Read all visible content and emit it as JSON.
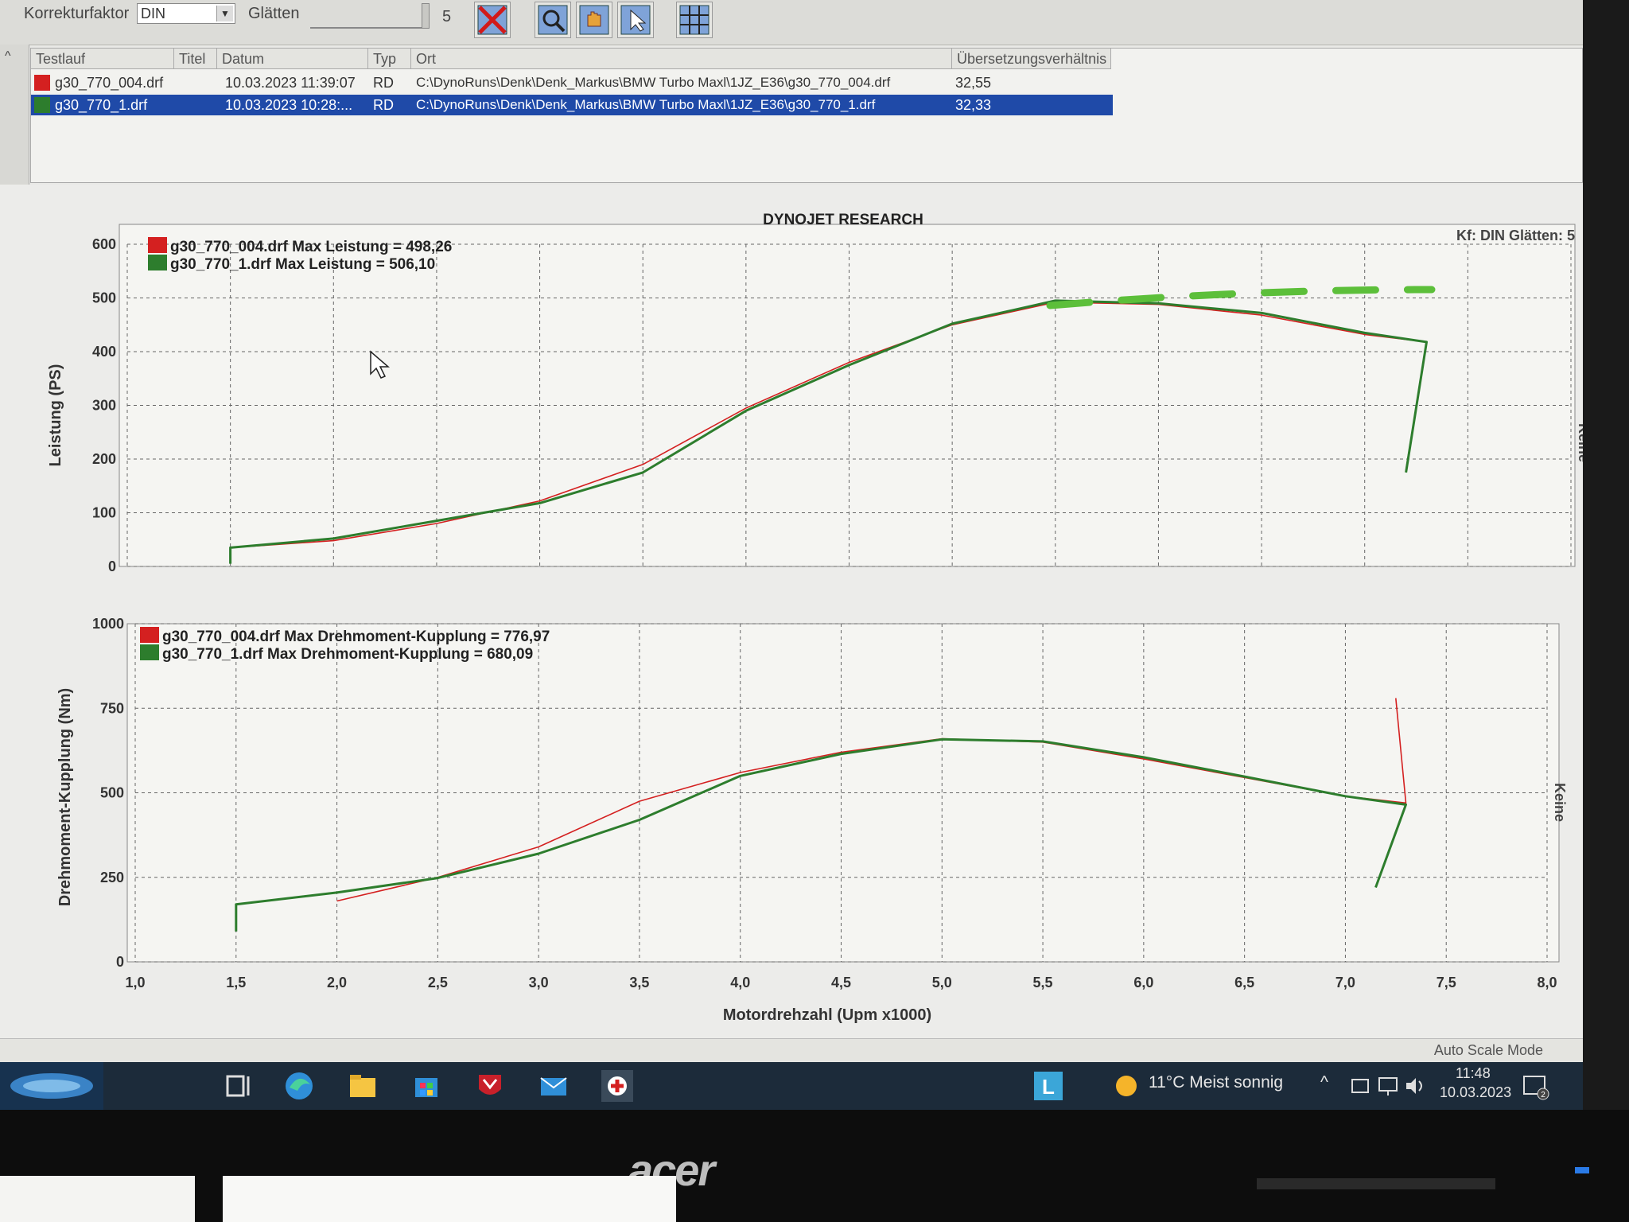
{
  "toolbar": {
    "korrektur_label": "Korrekturfaktor",
    "korrektur_value": "DIN",
    "glaetten_label": "Glätten",
    "glaetten_value": "5"
  },
  "runs_table": {
    "headers": [
      "Testlauf",
      "Titel",
      "Datum",
      "Typ",
      "Ort",
      "Übersetzungsverhältnis"
    ],
    "rows": [
      {
        "testlauf": "g30_770_004.drf",
        "datum": "10.03.2023 11:39:07",
        "typ": "RD",
        "ort": "C:\\DynoRuns\\Denk\\Denk_Markus\\BMW Turbo Maxl\\1JZ_E36\\g30_770_004.drf",
        "ratio": "32,55",
        "color": "#d42020"
      },
      {
        "testlauf": "g30_770_1.drf",
        "datum": "10.03.2023 10:28:...",
        "typ": "RD",
        "ort": "C:\\DynoRuns\\Denk\\Denk_Markus\\BMW Turbo Maxl\\1JZ_E36\\g30_770_1.drf",
        "ratio": "32,33",
        "color": "#2d7d2d"
      }
    ]
  },
  "chart_header": {
    "title": "DYNOJET RESEARCH",
    "kf": "Kf: DIN  Glätten: 5",
    "keine_top": "Keine",
    "keine_bottom": "Keine"
  },
  "chart_data": [
    {
      "type": "line",
      "ylabel": "Leistung (PS)",
      "xlabel": "Motordrehzahl (Upm x1000)",
      "xlim": [
        1.0,
        8.0
      ],
      "ylim": [
        0,
        600
      ],
      "yticks": [
        "0",
        "100",
        "200",
        "300",
        "400",
        "500",
        "600"
      ],
      "grid": true,
      "legend": [
        "g30_770_004.drf Max Leistung = 498,26",
        "g30_770_1.drf Max Leistung = 506,10"
      ],
      "series": [
        {
          "color": "#d42020",
          "points": [
            [
              1.5,
              35
            ],
            [
              2.0,
              48
            ],
            [
              2.5,
              80
            ],
            [
              3.0,
              122
            ],
            [
              3.5,
              190
            ],
            [
              4.0,
              295
            ],
            [
              4.5,
              380
            ],
            [
              5.0,
              450
            ],
            [
              5.5,
              492
            ],
            [
              6.0,
              488
            ],
            [
              6.5,
              468
            ],
            [
              7.0,
              432
            ],
            [
              7.3,
              418
            ],
            [
              7.2,
              180
            ]
          ]
        },
        {
          "color": "#2d7d2d",
          "points": [
            [
              1.5,
              5
            ],
            [
              1.5,
              35
            ],
            [
              2.0,
              52
            ],
            [
              2.5,
              85
            ],
            [
              3.0,
              118
            ],
            [
              3.5,
              175
            ],
            [
              4.0,
              290
            ],
            [
              4.5,
              375
            ],
            [
              5.0,
              452
            ],
            [
              5.5,
              495
            ],
            [
              6.0,
              490
            ],
            [
              6.5,
              472
            ],
            [
              7.0,
              435
            ],
            [
              7.3,
              418
            ],
            [
              7.2,
              175
            ]
          ]
        }
      ]
    },
    {
      "type": "line",
      "ylabel": "Drehmoment-Kupplung (Nm)",
      "xlabel": "Motordrehzahl (Upm x1000)",
      "xlim": [
        1.0,
        8.0
      ],
      "ylim": [
        0,
        1000
      ],
      "yticks": [
        "0",
        "250",
        "500",
        "750",
        "1000"
      ],
      "xticks": [
        "1,0",
        "1,5",
        "2,0",
        "2,5",
        "3,0",
        "3,5",
        "4,0",
        "4,5",
        "5,0",
        "5,5",
        "6,0",
        "6,5",
        "7,0",
        "7,5",
        "8,0"
      ],
      "grid": true,
      "legend": [
        "g30_770_004.drf Max Drehmoment-Kupplung = 776,97",
        "g30_770_1.drf Max Drehmoment-Kupplung = 680,09"
      ],
      "series": [
        {
          "color": "#d42020",
          "points": [
            [
              2.0,
              180
            ],
            [
              2.5,
              250
            ],
            [
              3.0,
              340
            ],
            [
              3.5,
              475
            ],
            [
              4.0,
              560
            ],
            [
              4.5,
              620
            ],
            [
              5.0,
              660
            ],
            [
              5.5,
              650
            ],
            [
              6.0,
              600
            ],
            [
              6.5,
              545
            ],
            [
              7.0,
              490
            ],
            [
              7.3,
              470
            ],
            [
              7.25,
              780
            ]
          ]
        },
        {
          "color": "#2d7d2d",
          "points": [
            [
              1.5,
              90
            ],
            [
              1.5,
              170
            ],
            [
              2.0,
              205
            ],
            [
              2.5,
              248
            ],
            [
              3.0,
              320
            ],
            [
              3.5,
              420
            ],
            [
              4.0,
              550
            ],
            [
              4.5,
              615
            ],
            [
              5.0,
              658
            ],
            [
              5.5,
              652
            ],
            [
              6.0,
              605
            ],
            [
              6.5,
              548
            ],
            [
              7.0,
              490
            ],
            [
              7.3,
              465
            ],
            [
              7.15,
              220
            ]
          ]
        }
      ]
    }
  ],
  "annotation_dashed_color": "#5cbf3a",
  "status": {
    "auto_scale": "Auto Scale Mode"
  },
  "taskbar": {
    "weather": "11°C  Meist sonnig",
    "time": "11:48",
    "date": "10.03.2023",
    "notif": "2"
  },
  "monitor": {
    "brand": "acer"
  }
}
